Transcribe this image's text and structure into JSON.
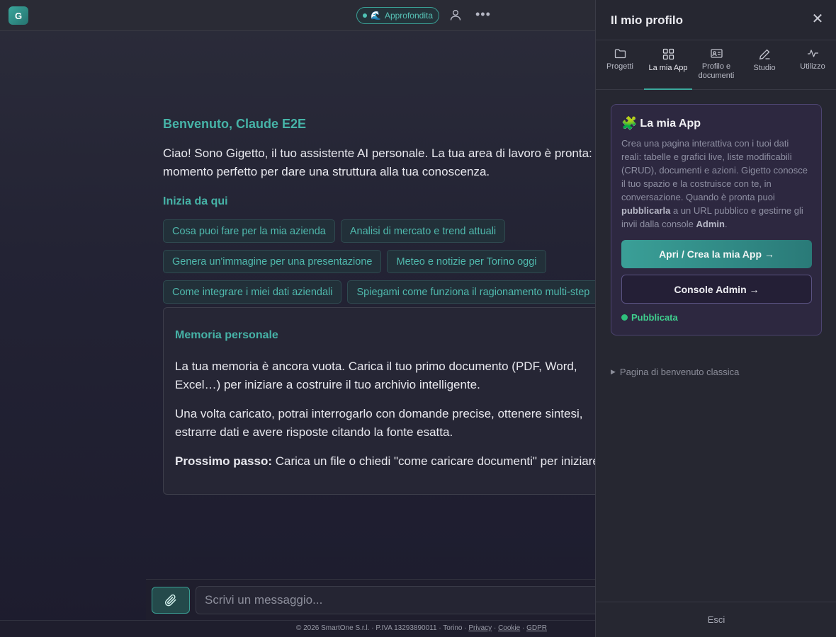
{
  "topbar": {
    "logo_letter": "G",
    "mode_label": "Approfondita",
    "more_label": "•••"
  },
  "main": {
    "welcome": "Benvenuto, Claude E2E",
    "intro": "Ciao! Sono Gigetto, il tuo assistente AI personale. La tua area di lavoro è pronta: è il momento perfetto per dare una struttura alla tua conoscenza.",
    "start_title": "Inizia da qui",
    "chips": [
      [
        "Cosa puoi fare per la mia azienda",
        "Analisi di mercato e trend attuali"
      ],
      [
        "Genera un'immagine per una presentazione",
        "Meteo e notizie per Torino oggi"
      ],
      [
        "Come integrare i miei dati aziendali",
        "Spiegami come funziona il ragionamento multi-step"
      ]
    ],
    "memory": {
      "title": "Memoria personale",
      "p1": "La tua memoria è ancora vuota. Carica il tuo primo documento (PDF, Word, Excel…) per iniziare a costruire il tuo archivio intelligente.",
      "p2": "Una volta caricato, potrai interrogarlo con domande precise, ottenere sintesi, estrarre dati e avere risposte citando la fonte esatta.",
      "next_label": "Prossimo passo:",
      "next_text": " Carica un file o chiedi \"come caricare documenti\" per iniziare."
    }
  },
  "composer": {
    "placeholder": "Scrivi un messaggio..."
  },
  "footer": {
    "text": "© 2026 SmartOne S.r.l. · P.IVA 13293890011 · Torino · ",
    "privacy": "Privacy",
    "cookie": "Cookie",
    "gdpr": "GDPR",
    "sep": " · "
  },
  "panel": {
    "title": "Il mio profilo",
    "close": "✕",
    "tabs": [
      {
        "label": "Progetti"
      },
      {
        "label": "La mia App"
      },
      {
        "label": "Profilo e documenti"
      },
      {
        "label": "Studio"
      },
      {
        "label": "Utilizzo"
      }
    ],
    "app_card": {
      "title": "La mia App",
      "desc_1": "Crea una pagina interattiva con i tuoi dati reali: tabelle e grafici live, liste modificabili (CRUD), documenti e azioni. Gigetto conosce il tuo spazio e la costruisce con te, in conversazione. Quando è pronta puoi ",
      "desc_bold_1": "pubblicarla",
      "desc_2": " a un URL pubblico e gestirne gli invii dalla console ",
      "desc_bold_2": "Admin",
      "desc_3": ".",
      "primary_button": "Apri / Crea la mia App →",
      "secondary_button": "Console Admin →",
      "status": "Pubblicata"
    },
    "classic_link": "Pagina di benvenuto classica",
    "logout": "Esci"
  },
  "colors": {
    "accent": "#46b3a7",
    "published": "#3fcf8e",
    "card_border": "#4c4470"
  }
}
